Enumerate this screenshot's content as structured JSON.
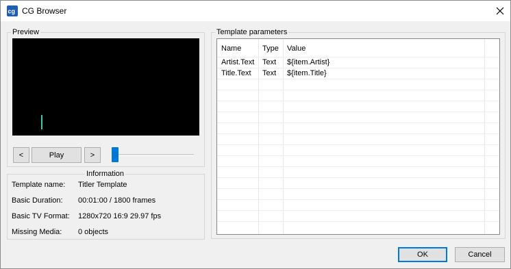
{
  "window": {
    "title": "CG Browser",
    "app_icon": "cg-app-icon"
  },
  "preview": {
    "group_label": "Preview",
    "prev_label": "<",
    "play_label": "Play",
    "next_label": ">",
    "screen_color": "#000000",
    "caret_color": "#39c7b0",
    "slider_position": 0
  },
  "information": {
    "group_label": "Information",
    "rows": [
      {
        "label": "Template name:",
        "value": "Titler Template"
      },
      {
        "label": "Basic Duration:",
        "value": "00:01:00 / 1800 frames"
      },
      {
        "label": "Basic TV Format:",
        "value": "1280x720 16:9 29.97 fps"
      },
      {
        "label": "Missing Media:",
        "value": "0 objects"
      }
    ]
  },
  "template_parameters": {
    "group_label": "Template parameters",
    "columns": [
      "Name",
      "Type",
      "Value"
    ],
    "rows": [
      [
        "Artist.Text",
        "Text",
        "${item.Artist}"
      ],
      [
        "Title.Text",
        "Text",
        "${item.Title}"
      ]
    ]
  },
  "footer": {
    "ok_label": "OK",
    "cancel_label": "Cancel",
    "accent_color": "#0078d7"
  }
}
